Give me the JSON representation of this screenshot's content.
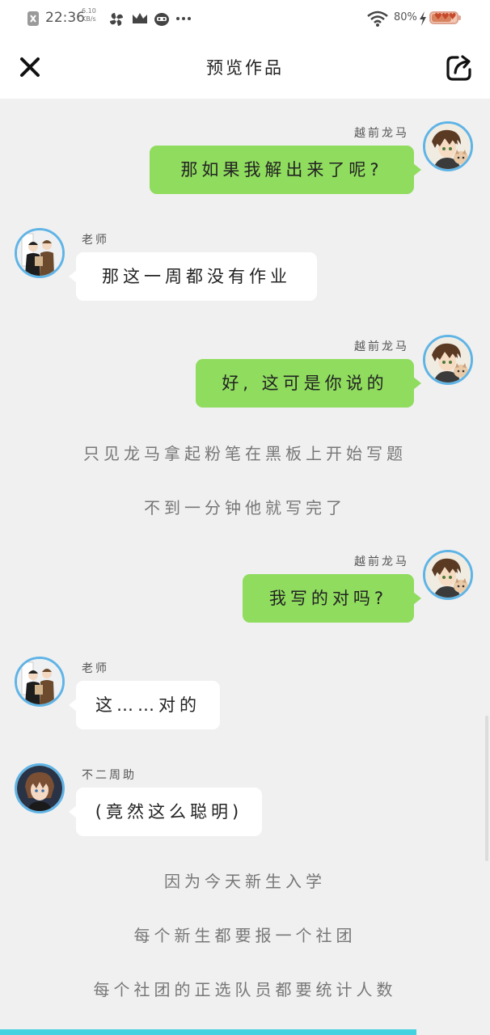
{
  "status_bar": {
    "time": "22:36",
    "net_speed_value": "6.10",
    "net_speed_unit": "KB/s",
    "battery_percent": "80%",
    "battery_level": 0.8
  },
  "header": {
    "title": "预览作品",
    "close_icon": "close-icon",
    "share_icon": "share-icon"
  },
  "colors": {
    "accent": "#42d2e0",
    "right_bubble": "#8fdc5e",
    "left_bubble": "#ffffff",
    "avatar_border": "#5fb4e6"
  },
  "messages": [
    {
      "type": "right",
      "speaker": "越前龙马",
      "text": "那如果我解出来了呢?"
    },
    {
      "type": "left",
      "speaker": "老师",
      "text": "那这一周都没有作业"
    },
    {
      "type": "right",
      "speaker": "越前龙马",
      "text": "好, 这可是你说的"
    },
    {
      "type": "narration",
      "text": "只见龙马拿起粉笔在黑板上开始写题"
    },
    {
      "type": "narration",
      "text": "不到一分钟他就写完了"
    },
    {
      "type": "right",
      "speaker": "越前龙马",
      "text": "我写的对吗?"
    },
    {
      "type": "left",
      "speaker": "老师",
      "text": "这……对的"
    },
    {
      "type": "left",
      "speaker": "不二周助",
      "text": "(竟然这么聪明)"
    },
    {
      "type": "narration",
      "text": "因为今天新生入学"
    },
    {
      "type": "narration",
      "text": "每个新生都要报一个社团"
    },
    {
      "type": "narration",
      "text": "每个社团的正选队员都要统计人数"
    }
  ],
  "reading_progress": 0.85
}
